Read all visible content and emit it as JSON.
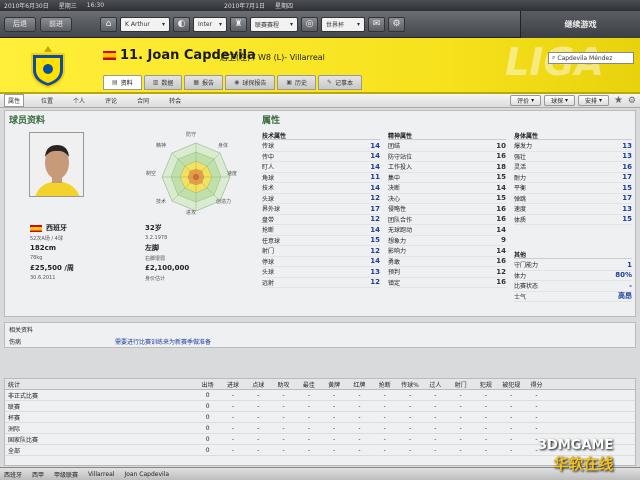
{
  "topbar": {
    "date": "2010年6月30日",
    "weekday": "星期三",
    "time": "16:30",
    "game_date": "2010年7月1日",
    "game_weekday": "星期四"
  },
  "nav": {
    "back": "后退",
    "forward": "前进",
    "manager_select": "K Arthur",
    "inbox_select": "Inter",
    "competition_select": "联赛赛程",
    "world_select": "世界杯",
    "continue": "继续游戏"
  },
  "player": {
    "name": "11. Joan Capdevila",
    "role": "后卫(左) / W8 (L)- Villarreal"
  },
  "header": {
    "liga_watermark": "LIGA",
    "search_value": "Capdevila Méndez"
  },
  "tabs": [
    {
      "label": "资料",
      "icon": "document-icon"
    },
    {
      "label": "数据",
      "icon": "chart-icon"
    },
    {
      "label": "报告",
      "icon": "report-icon"
    },
    {
      "label": "球探报告",
      "icon": "scout-icon"
    },
    {
      "label": "历史",
      "icon": "history-icon"
    },
    {
      "label": "记事本",
      "icon": "notebook-icon"
    }
  ],
  "subtabs": [
    "属性",
    "位置",
    "个人",
    "评论",
    "合同",
    "转会"
  ],
  "subbuttons": [
    "评价",
    "球探",
    "安排"
  ],
  "profile": {
    "title": "球员资料",
    "radar_labels": {
      "top": "防守",
      "topright": "身体",
      "right": "速度",
      "bottomright": "创造力",
      "bottom": "进攻",
      "bottomleft": "技术",
      "left": "制空",
      "topleft": "精神"
    },
    "nationality": "西班牙",
    "intl": "52次A场 / 4球",
    "age": "32岁",
    "dob": "3.2.1978",
    "height": "182cm",
    "weight": "78kg",
    "foot": "左脚",
    "foot_detail": "右脚很弱",
    "wage": "£25,500 /周",
    "contract_end": "30.6.2011",
    "value": "£2,100,000",
    "value_note": "身价估计"
  },
  "attributes": {
    "title": "属性",
    "technical": {
      "head": "技术属性",
      "rows": [
        {
          "n": "传球",
          "v": "14"
        },
        {
          "n": "传中",
          "v": "14"
        },
        {
          "n": "盯人",
          "v": "14"
        },
        {
          "n": "角球",
          "v": "11"
        },
        {
          "n": "技术",
          "v": "14"
        },
        {
          "n": "头球",
          "v": "12"
        },
        {
          "n": "界外球",
          "v": "17"
        },
        {
          "n": "盘带",
          "v": "12"
        },
        {
          "n": "抢断",
          "v": "14"
        },
        {
          "n": "任意球",
          "v": "15"
        },
        {
          "n": "射门",
          "v": "12"
        },
        {
          "n": "停球",
          "v": "14"
        },
        {
          "n": "头球",
          "v": "13"
        },
        {
          "n": "远射",
          "v": "12"
        }
      ]
    },
    "mental": {
      "head": "精神属性",
      "rows": [
        {
          "n": "团结",
          "v": "10"
        },
        {
          "n": "防守站位",
          "v": "16"
        },
        {
          "n": "工作投入",
          "v": "18"
        },
        {
          "n": "集中",
          "v": "15"
        },
        {
          "n": "决断",
          "v": "14"
        },
        {
          "n": "决心",
          "v": "15"
        },
        {
          "n": "侵略性",
          "v": "16"
        },
        {
          "n": "团队合作",
          "v": "16"
        },
        {
          "n": "无球跑动",
          "v": "14"
        },
        {
          "n": "想象力",
          "v": "9"
        },
        {
          "n": "影响力",
          "v": "14"
        },
        {
          "n": "勇敢",
          "v": "16"
        },
        {
          "n": "预判",
          "v": "12"
        },
        {
          "n": "镇定",
          "v": "16"
        }
      ]
    },
    "physical": {
      "head": "身体属性",
      "rows": [
        {
          "n": "爆发力",
          "v": "13"
        },
        {
          "n": "强壮",
          "v": "13"
        },
        {
          "n": "灵活",
          "v": "16"
        },
        {
          "n": "耐力",
          "v": "17"
        },
        {
          "n": "平衡",
          "v": "15"
        },
        {
          "n": "弹跳",
          "v": "17"
        },
        {
          "n": "速度",
          "v": "13"
        },
        {
          "n": "体质",
          "v": "15"
        }
      ]
    },
    "other": {
      "head": "其他",
      "rows": [
        {
          "n": "守门能力",
          "v": "1"
        },
        {
          "n": "体力",
          "v": "80%"
        },
        {
          "n": "比赛状态",
          "v": "-"
        },
        {
          "n": "士气",
          "v": "高昂"
        }
      ]
    }
  },
  "info": {
    "section": "相关资料",
    "injury_label": "伤病",
    "injury_text": "需要进行比赛训练来为新赛季做准备"
  },
  "stats": {
    "headers": [
      "统计",
      "出场",
      "进球",
      "点球",
      "助攻",
      "最佳",
      "黄牌",
      "红牌",
      "抢断",
      "传球%",
      "过人",
      "射门",
      "犯规",
      "被犯规",
      "得分"
    ],
    "rows": [
      {
        "label": "非正式比赛",
        "apps": "0"
      },
      {
        "label": "联赛",
        "apps": "0"
      },
      {
        "label": "杯赛",
        "apps": "0"
      },
      {
        "label": "洲际",
        "apps": "0"
      },
      {
        "label": "国家队比赛",
        "apps": "0"
      },
      {
        "label": "全部",
        "apps": "0"
      }
    ],
    "dash": "-"
  },
  "breadcrumb": [
    "西班牙",
    "西甲",
    "甲级联赛",
    "Villarreal",
    "Joan Capdevila"
  ],
  "watermark": {
    "line1": "3DMGAME",
    "line2": "华软在线"
  },
  "colors": {
    "club_yellow": "#f6e11c",
    "attr_blue": "#1b3d9a",
    "section_green": "#3a6b3a"
  }
}
